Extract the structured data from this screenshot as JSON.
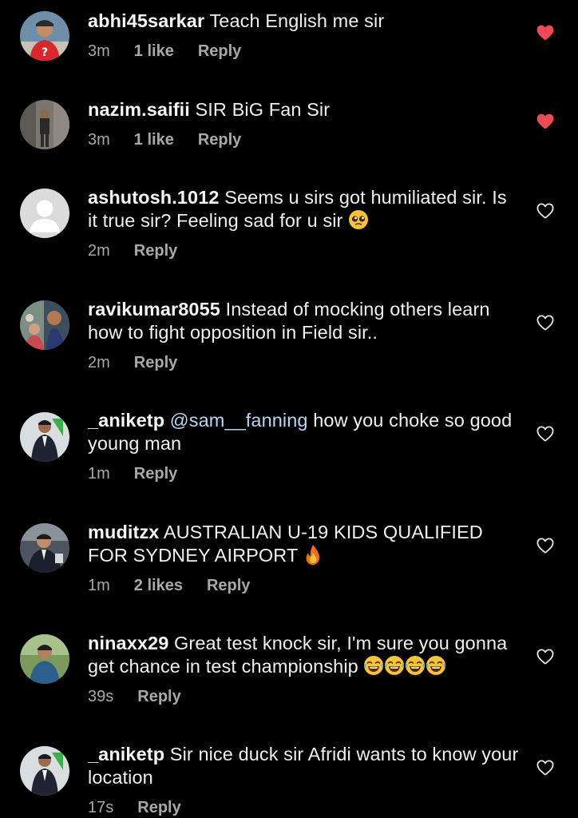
{
  "colors": {
    "background": "#000000",
    "text": "#efefef",
    "meta": "#a8a8a8",
    "mention": "#b9d4f6",
    "liked_heart": "#ed4956"
  },
  "comments": [
    {
      "username": "abhi45sarkar",
      "text": "Teach English me sir",
      "time": "3m",
      "likes": "1 like",
      "reply": "Reply",
      "liked": true,
      "avatar": "user-avatar-red-shirt"
    },
    {
      "username": "nazim.saifii",
      "text": "SIR BiG Fan Sir",
      "time": "3m",
      "likes": "1 like",
      "reply": "Reply",
      "liked": true,
      "avatar": "user-avatar-standing-person"
    },
    {
      "username": "ashutosh.1012",
      "text": "Seems u sirs got humiliated sir. Is it true sir? Feeling sad for u sir",
      "emoji": "pleading-face-emoji",
      "time": "2m",
      "reply": "Reply",
      "liked": false,
      "avatar": "default-avatar"
    },
    {
      "username": "ravikumar8055",
      "text": "Instead of mocking others learn how to fight opposition in Field sir..",
      "time": "2m",
      "reply": "Reply",
      "liked": false,
      "avatar": "user-avatar-selfie"
    },
    {
      "username": "_aniketp",
      "mention": "@sam__fanning",
      "text": "how you choke so good young man",
      "time": "1m",
      "reply": "Reply",
      "liked": false,
      "avatar": "user-avatar-suit"
    },
    {
      "username": "muditzx",
      "text": "AUSTRALIAN U-19 KIDS QUALIFIED FOR SYDNEY AIRPORT",
      "emoji": "fire-emoji",
      "time": "1m",
      "likes": "2 likes",
      "reply": "Reply",
      "liked": false,
      "avatar": "user-avatar-man-suit"
    },
    {
      "username": "ninaxx29",
      "text": "Great test knock sir, I'm sure you gonna get chance in test championship",
      "emoji": "tears-of-joy-emoji x4",
      "time": "39s",
      "reply": "Reply",
      "liked": false,
      "avatar": "user-avatar-young-man"
    },
    {
      "username": "_aniketp",
      "text": "Sir nice duck sir Afridi wants to know your location",
      "time": "17s",
      "reply": "Reply",
      "liked": false,
      "avatar": "user-avatar-suit"
    }
  ]
}
